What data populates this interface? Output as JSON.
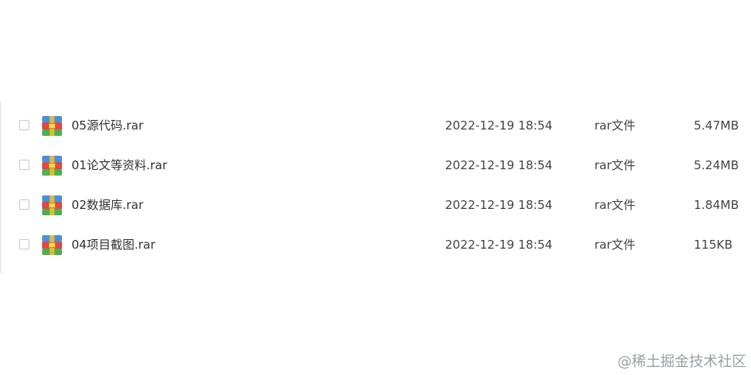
{
  "files": [
    {
      "name": "05源代码.rar",
      "date": "2022-12-19 18:54",
      "type": "rar文件",
      "size": "5.47MB",
      "icon": "rar-archive-icon"
    },
    {
      "name": "01论文等资料.rar",
      "date": "2022-12-19 18:54",
      "type": "rar文件",
      "size": "5.24MB",
      "icon": "rar-archive-icon"
    },
    {
      "name": "02数据库.rar",
      "date": "2022-12-19 18:54",
      "type": "rar文件",
      "size": "1.84MB",
      "icon": "rar-archive-icon"
    },
    {
      "name": "04项目截图.rar",
      "date": "2022-12-19 18:54",
      "type": "rar文件",
      "size": "115KB",
      "icon": "rar-archive-icon"
    }
  ],
  "watermark": "@稀土掘金技术社区",
  "colors": {
    "icon_top": "#4a90d9",
    "icon_middle": "#e04848",
    "icon_bottom": "#4caf50",
    "icon_clasp": "#f2c230"
  }
}
